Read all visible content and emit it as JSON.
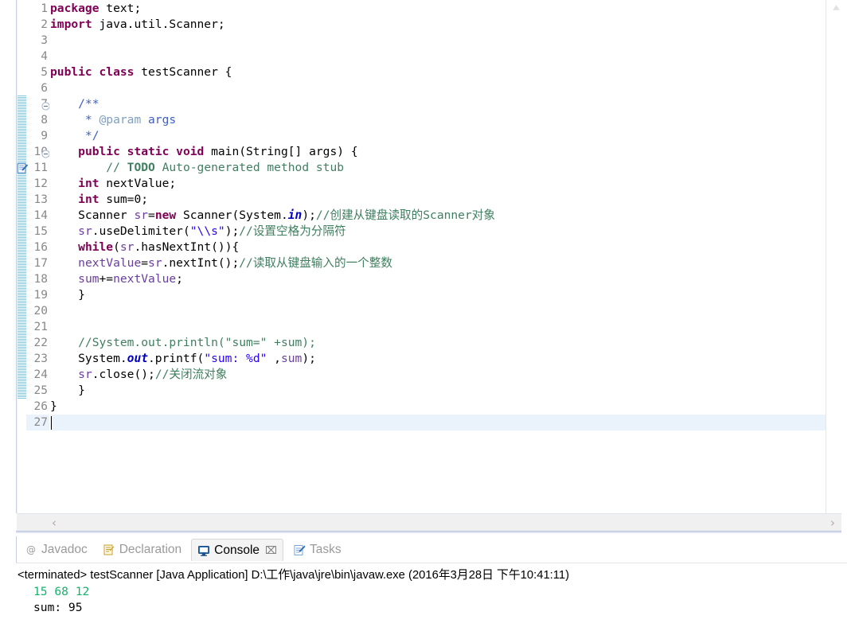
{
  "editor": {
    "language": "java",
    "first_line": 1,
    "total_lines": 27,
    "current_line": 27,
    "gutter_icons": {
      "fold_collapse": "fold-collapse-icon",
      "task": "todo-task-icon"
    },
    "fold_lines": [
      7,
      10
    ],
    "task_marker_line": 11,
    "change_bar_from_line": 7,
    "change_bar_to_line": 25,
    "lines": [
      {
        "n": 1,
        "tokens": [
          {
            "t": "package ",
            "c": "kw"
          },
          {
            "t": "text;",
            "c": "plain"
          }
        ]
      },
      {
        "n": 2,
        "tokens": [
          {
            "t": "import ",
            "c": "kw"
          },
          {
            "t": "java.util.Scanner;",
            "c": "plain"
          }
        ]
      },
      {
        "n": 3,
        "tokens": []
      },
      {
        "n": 4,
        "tokens": []
      },
      {
        "n": 5,
        "tokens": [
          {
            "t": "public class ",
            "c": "kw"
          },
          {
            "t": "testScanner {",
            "c": "plain"
          }
        ]
      },
      {
        "n": 6,
        "tokens": []
      },
      {
        "n": 7,
        "tokens": [
          {
            "t": "    /**",
            "c": "jdoc"
          }
        ]
      },
      {
        "n": 8,
        "tokens": [
          {
            "t": "     * ",
            "c": "jdoc"
          },
          {
            "t": "@param",
            "c": "jdoctag"
          },
          {
            "t": " args",
            "c": "jdoc"
          }
        ]
      },
      {
        "n": 9,
        "tokens": [
          {
            "t": "     */",
            "c": "jdoc"
          }
        ]
      },
      {
        "n": 10,
        "tokens": [
          {
            "t": "    ",
            "c": "plain"
          },
          {
            "t": "public static void ",
            "c": "kw"
          },
          {
            "t": "main(String[] args) {",
            "c": "plain"
          }
        ]
      },
      {
        "n": 11,
        "tokens": [
          {
            "t": "        // ",
            "c": "cmt"
          },
          {
            "t": "TODO",
            "c": "todo"
          },
          {
            "t": " Auto-generated method stub",
            "c": "cmt"
          }
        ]
      },
      {
        "n": 12,
        "tokens": [
          {
            "t": "    ",
            "c": "plain"
          },
          {
            "t": "int",
            "c": "kw"
          },
          {
            "t": " nextValue;",
            "c": "plain"
          }
        ]
      },
      {
        "n": 13,
        "tokens": [
          {
            "t": "    ",
            "c": "plain"
          },
          {
            "t": "int",
            "c": "kw"
          },
          {
            "t": " sum=0;",
            "c": "plain"
          }
        ]
      },
      {
        "n": 14,
        "tokens": [
          {
            "t": "    Scanner ",
            "c": "plain"
          },
          {
            "t": "sr",
            "c": "lvar"
          },
          {
            "t": "=",
            "c": "plain"
          },
          {
            "t": "new",
            "c": "kw"
          },
          {
            "t": " Scanner(System.",
            "c": "plain"
          },
          {
            "t": "in",
            "c": "fld"
          },
          {
            "t": ");",
            "c": "plain"
          },
          {
            "t": "//创建从键盘读取的Scanner对象",
            "c": "cmt"
          }
        ]
      },
      {
        "n": 15,
        "tokens": [
          {
            "t": "    ",
            "c": "plain"
          },
          {
            "t": "sr",
            "c": "lvar"
          },
          {
            "t": ".useDelimiter(",
            "c": "plain"
          },
          {
            "t": "\"\\\\s\"",
            "c": "str"
          },
          {
            "t": ");",
            "c": "plain"
          },
          {
            "t": "//设置空格为分隔符",
            "c": "cmt"
          }
        ]
      },
      {
        "n": 16,
        "tokens": [
          {
            "t": "    ",
            "c": "plain"
          },
          {
            "t": "while",
            "c": "kw"
          },
          {
            "t": "(",
            "c": "plain"
          },
          {
            "t": "sr",
            "c": "lvar"
          },
          {
            "t": ".hasNextInt()){",
            "c": "plain"
          }
        ]
      },
      {
        "n": 17,
        "tokens": [
          {
            "t": "    ",
            "c": "plain"
          },
          {
            "t": "nextValue",
            "c": "lvar"
          },
          {
            "t": "=",
            "c": "plain"
          },
          {
            "t": "sr",
            "c": "lvar"
          },
          {
            "t": ".nextInt();",
            "c": "plain"
          },
          {
            "t": "//读取从键盘输入的一个整数",
            "c": "cmt"
          }
        ]
      },
      {
        "n": 18,
        "tokens": [
          {
            "t": "    ",
            "c": "plain"
          },
          {
            "t": "sum",
            "c": "lvar"
          },
          {
            "t": "+=",
            "c": "plain"
          },
          {
            "t": "nextValue",
            "c": "lvar"
          },
          {
            "t": ";",
            "c": "plain"
          }
        ]
      },
      {
        "n": 19,
        "tokens": [
          {
            "t": "    }",
            "c": "plain"
          }
        ]
      },
      {
        "n": 20,
        "tokens": []
      },
      {
        "n": 21,
        "tokens": []
      },
      {
        "n": 22,
        "tokens": [
          {
            "t": "    //System.out.println(\"sum=\" +sum);",
            "c": "cmt"
          }
        ]
      },
      {
        "n": 23,
        "tokens": [
          {
            "t": "    System.",
            "c": "plain"
          },
          {
            "t": "out",
            "c": "fld"
          },
          {
            "t": ".printf(",
            "c": "plain"
          },
          {
            "t": "\"sum: %d\"",
            "c": "str"
          },
          {
            "t": " ,",
            "c": "plain"
          },
          {
            "t": "sum",
            "c": "lvar"
          },
          {
            "t": ");",
            "c": "plain"
          }
        ]
      },
      {
        "n": 24,
        "tokens": [
          {
            "t": "    ",
            "c": "plain"
          },
          {
            "t": "sr",
            "c": "lvar"
          },
          {
            "t": ".close();",
            "c": "plain"
          },
          {
            "t": "//关闭流对象",
            "c": "cmt"
          }
        ]
      },
      {
        "n": 25,
        "tokens": [
          {
            "t": "    }",
            "c": "plain"
          }
        ]
      },
      {
        "n": 26,
        "tokens": [
          {
            "t": "}",
            "c": "plain"
          }
        ]
      },
      {
        "n": 27,
        "tokens": []
      }
    ]
  },
  "editor_scrollbars": {
    "vertical_up_arrow": "scroll-up-arrow",
    "horizontal_left_arrow": "‹",
    "horizontal_right_arrow": "›"
  },
  "bottom_view": {
    "tabs": [
      {
        "label": "Javadoc",
        "icon": "javadoc-icon",
        "active": false,
        "closable": false
      },
      {
        "label": "Declaration",
        "icon": "declaration-icon",
        "active": false,
        "closable": false
      },
      {
        "label": "Console",
        "icon": "console-icon",
        "active": true,
        "closable": true,
        "close_glyph": "⌧"
      },
      {
        "label": "Tasks",
        "icon": "tasks-icon",
        "active": false,
        "closable": false
      }
    ],
    "console": {
      "header": "<terminated> testScanner [Java Application] D:\\工作\\java\\jre\\bin\\javaw.exe (2016年3月28日 下午10:41:11)",
      "output": [
        {
          "text": "15 68 12",
          "kind": "input-echo"
        },
        {
          "text": "sum: 95",
          "kind": "stdout"
        }
      ]
    }
  },
  "colors": {
    "keyword": "#7f0055",
    "comment": "#3f7f5f",
    "javadoc": "#3f5fbf",
    "string": "#2a00ff",
    "static_field": "#0000c0",
    "local_var": "#6a3e9e",
    "current_line_highlight": "#eaf2fb",
    "change_bar": "#7fc6dd",
    "console_input_echo": "#15b36b"
  }
}
